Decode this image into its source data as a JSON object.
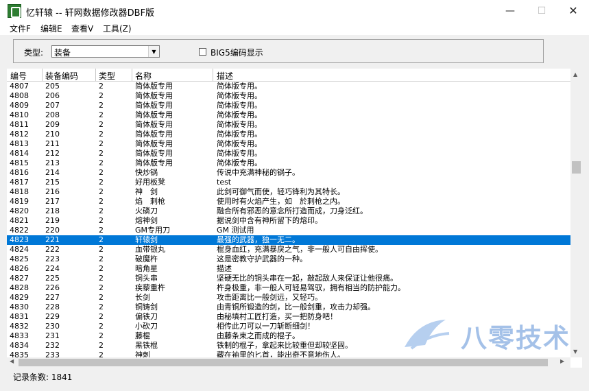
{
  "window": {
    "title": "忆轩辕 -- 轩网数据修改器DBF版",
    "minimize": "—",
    "maximize": "☐",
    "close": "✕"
  },
  "menu": [
    "文件F",
    "编辑E",
    "查看V",
    "工具(Z)"
  ],
  "filter": {
    "type_label": "类型:",
    "type_value": "装备",
    "big5_label": "BIG5编码显示",
    "big5_checked": false
  },
  "columns": [
    "编号",
    "装备编码",
    "类型",
    "名称",
    "描述"
  ],
  "rows": [
    [
      "4807",
      "205",
      "2",
      "简体版专用",
      "简体版专用。"
    ],
    [
      "4808",
      "206",
      "2",
      "简体版专用",
      "简体版专用。"
    ],
    [
      "4809",
      "207",
      "2",
      "简体版专用",
      "简体版专用。"
    ],
    [
      "4810",
      "208",
      "2",
      "简体版专用",
      "简体版专用。"
    ],
    [
      "4811",
      "209",
      "2",
      "简体版专用",
      "简体版专用。"
    ],
    [
      "4812",
      "210",
      "2",
      "简体版专用",
      "简体版专用。"
    ],
    [
      "4813",
      "211",
      "2",
      "简体版专用",
      "简体版专用。"
    ],
    [
      "4814",
      "212",
      "2",
      "简体版专用",
      "简体版专用。"
    ],
    [
      "4815",
      "213",
      "2",
      "简体版专用",
      "简体版专用。"
    ],
    [
      "4816",
      "214",
      "2",
      "快炒锅",
      "传说中充满神秘的锅子。"
    ],
    [
      "4817",
      "215",
      "2",
      "好用板凳",
      "test"
    ],
    [
      "4818",
      "216",
      "2",
      "神　剑",
      "此剑可御气而使，轻巧锋利为其特长。"
    ],
    [
      "4819",
      "217",
      "2",
      "焰　刺枪",
      "使用时有火焰产生，如　於刺枪之内。"
    ],
    [
      "4820",
      "218",
      "2",
      "火磷刀",
      "融合所有邪恶的意念所打造而成，刀身泛红。"
    ],
    [
      "4821",
      "219",
      "2",
      "熔神剑",
      "据说剑中含有神所留下的熔印。"
    ],
    [
      "4822",
      "220",
      "2",
      "GM专用刀",
      "GM 测试用"
    ],
    [
      "4823",
      "221",
      "2",
      "轩辕剑",
      "最强的武器，独一无二。"
    ],
    [
      "4824",
      "222",
      "2",
      "血带银丸",
      "棍身血红，充满暴戾之气，非一般人可自由挥使。"
    ],
    [
      "4825",
      "223",
      "2",
      "破魔杵",
      "这是密教守护武器的一种。"
    ],
    [
      "4826",
      "224",
      "2",
      "暗角星",
      "描述"
    ],
    [
      "4827",
      "225",
      "2",
      "铜头串",
      "坚硬无比的铜头串在一起，敲起敌人来保证让他很痛。"
    ],
    [
      "4828",
      "226",
      "2",
      "疾藜重杵",
      "杵身极重，非一般人可轻易驾驭，拥有相当的防护能力。"
    ],
    [
      "4829",
      "227",
      "2",
      "长剑",
      "攻击距离比一般剑远，又轻巧。"
    ],
    [
      "4830",
      "228",
      "2",
      "铜铸剑",
      "由青铜所锻造的剑，比一般剑重，攻击力却强。"
    ],
    [
      "4831",
      "229",
      "2",
      "偏铁刀",
      "由秘填村工匠打造，买一把防身吧！"
    ],
    [
      "4832",
      "230",
      "2",
      "小砍刀",
      "相传此刀可以一刀斩断细剑！"
    ],
    [
      "4833",
      "231",
      "2",
      "藤棍",
      "由藤条束之而成的棍子。"
    ],
    [
      "4834",
      "232",
      "2",
      "黑铁棍",
      "铁制的棍子，拿起来比较重但却较坚固。"
    ],
    [
      "4835",
      "233",
      "2",
      "神刺",
      "藏在袖里的匕首，能出奇不意地伤人。"
    ]
  ],
  "selected_index": 16,
  "status": "记录条数: 1841",
  "watermark": "八零技术",
  "colors": {
    "selection": "#0078d7",
    "watermark": "#5b8fd6"
  }
}
